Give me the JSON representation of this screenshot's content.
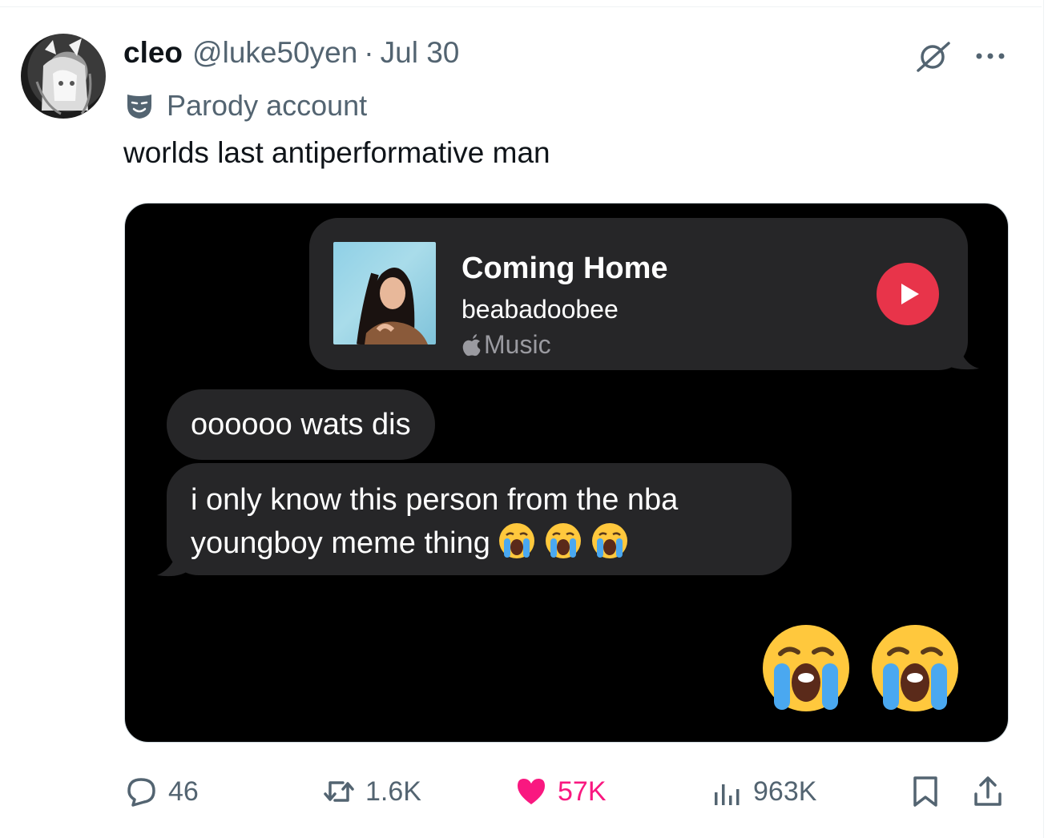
{
  "tweet": {
    "author": {
      "display_name": "cleo",
      "handle": "@luke50yen",
      "separator": "·",
      "date": "Jul 30",
      "label": "Parody account",
      "label_icon": "theater-mask-icon",
      "avatar": "avatar"
    },
    "text": "worlds last antiperformative man",
    "header_icons": [
      "grok-icon",
      "more-icon"
    ],
    "media": {
      "song_card": {
        "title": "Coming Home",
        "artist": "beabadoobee",
        "service": "Music",
        "service_icon": "apple-logo-icon",
        "play_icon": "play-icon",
        "play_color": "#e8344a"
      },
      "messages": [
        {
          "text": "oooooo wats dis"
        },
        {
          "line1": "i only know this person from the nba",
          "line2": "youngboy meme thing",
          "emoji": [
            "loudly-crying-face",
            "loudly-crying-face",
            "loudly-crying-face"
          ]
        }
      ],
      "big_emoji": [
        "loudly-crying-face",
        "loudly-crying-face"
      ]
    },
    "actions": {
      "replies": "46",
      "reposts": "1.6K",
      "likes": "57K",
      "views": "963K",
      "like_color": "#f91880",
      "icons": [
        "reply-icon",
        "repost-icon",
        "heart-icon",
        "views-icon",
        "bookmark-icon",
        "share-icon"
      ]
    }
  }
}
